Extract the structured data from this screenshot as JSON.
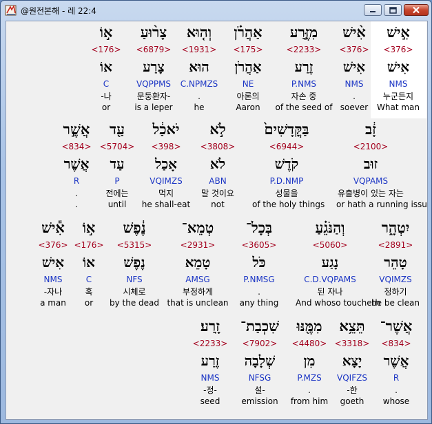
{
  "window": {
    "title": "@원전본해 - 레 22:4",
    "controls": {
      "minimize": "minimize",
      "maximize": "maximize",
      "close": "close"
    }
  },
  "icons": {
    "app": "book-icon"
  },
  "colors": {
    "strong": "#a3001d",
    "parse": "#1a34c4",
    "highlight": "#ffffff"
  },
  "verse_lines": [
    {
      "words": [
        {
          "heb": "אִ֣ישׁ",
          "strong": "<376>",
          "lemma": "אִישׁ",
          "parse": "NMS",
          "kor": "누군든지",
          "eng": "What man"
        },
        {
          "heb": "אִ֨ישׁ",
          "strong": "<376>",
          "lemma": "אִישׁ",
          "parse": "NMS",
          "kor": ".",
          "eng": "soever"
        },
        {
          "heb": "מִזֶּ֣רַע",
          "strong": "<2233>",
          "lemma": "זֶרַע",
          "parse": "P.NMS",
          "kor": "자손 중",
          "eng": "of the seed of"
        },
        {
          "heb": "אַהֲרֹ֗ן",
          "strong": "<175>",
          "lemma": "אַהֲרֹן",
          "parse": "NE",
          "kor": "아론의",
          "eng": "Aaron"
        },
        {
          "heb": "וְה֤וּא",
          "strong": "<1931>",
          "lemma": "הוּא",
          "parse": "C.NPMZS",
          "kor": ".",
          "eng": "he"
        },
        {
          "heb": "צָר֨וּעַ",
          "strong": "<6879>",
          "lemma": "צָרַע",
          "parse": "VQPPMS",
          "kor": "문둥환자-",
          "eng": "is a leper"
        },
        {
          "heb": "א֣וֹ",
          "strong": "<176>",
          "lemma": "אוֹ",
          "parse": "C",
          "kor": "-나",
          "eng": "or"
        }
      ]
    },
    {
      "words": [
        {
          "heb": "זָ֔ב",
          "strong": "<2100>",
          "lemma": "זוּב",
          "parse": "VQPAMS",
          "kor": "유출병이 있는 자는",
          "eng": "or hath a running issue"
        },
        {
          "heb": "בַּקֳּדָשִׁים֙",
          "strong": "<6944>",
          "lemma": "קֹדֶשׁ",
          "parse": "P.D.NMP",
          "kor": "성물을",
          "eng": "of the holy things"
        },
        {
          "heb": "לֹ֣א",
          "strong": "<3808>",
          "lemma": "לֹא",
          "parse": "ABN",
          "kor": "말 것이요",
          "eng": "not"
        },
        {
          "heb": "יֹאכַ֔ל",
          "strong": "<398>",
          "lemma": "אָכַל",
          "parse": "VQIMZS",
          "kor": "먹지",
          "eng": "he shall-eat"
        },
        {
          "heb": "עַ֖ד",
          "strong": "<5704>",
          "lemma": "עַד",
          "parse": "P",
          "kor": "전에는",
          "eng": "until"
        },
        {
          "heb": "אֲשֶׁ֣ר",
          "strong": "<834>",
          "lemma": "אֲשֶׁר",
          "parse": "R",
          "kor": ".",
          "eng": "."
        }
      ]
    },
    {
      "words": [
        {
          "heb": "יִטְהָ֑ר",
          "strong": "<2891>",
          "lemma": "טָהֵר",
          "parse": "VQIMZS",
          "kor": "정하기",
          "eng": "he be clean"
        },
        {
          "heb": "וְהַנֹּגֵ֗עַ",
          "strong": "<5060>",
          "lemma": "נָגַע",
          "parse": "C.D.VQPAMS",
          "kor": "된 자나",
          "eng": "And whoso toucheth"
        },
        {
          "heb": "בְּכָל־",
          "strong": "<3605>",
          "lemma": "כֹּל",
          "parse": "P.NMSG",
          "kor": ".",
          "eng": "any thing"
        },
        {
          "heb": "טְמֵא־",
          "strong": "<2931>",
          "lemma": "טָמֵא",
          "parse": "AMSG",
          "kor": "부정하게",
          "eng": "that is unclean"
        },
        {
          "heb": "נֶ֔פֶשׁ",
          "strong": "<5315>",
          "lemma": "נֶפֶשׁ",
          "parse": "NFS",
          "kor": "시체로",
          "eng": "by the dead"
        },
        {
          "heb": "א֣וֹ",
          "strong": "<176>",
          "lemma": "אוֹ",
          "parse": "C",
          "kor": "혹",
          "eng": "or"
        },
        {
          "heb": "אִ֕ישׁ",
          "strong": "<376>",
          "lemma": "אִישׁ",
          "parse": "NMS",
          "kor": "-자나",
          "eng": "a man"
        }
      ]
    },
    {
      "words": [
        {
          "heb": "אֲשֶׁר־",
          "strong": "<834>",
          "lemma": "אֲשֶׁר",
          "parse": "R",
          "kor": ".",
          "eng": "whose"
        },
        {
          "heb": "תֵּצֵ֥א",
          "strong": "<3318>",
          "lemma": "יָצָא",
          "parse": "VQIFZS",
          "kor": "-한",
          "eng": "goeth"
        },
        {
          "heb": "מִמֶּ֖נּוּ",
          "strong": "<4480>",
          "lemma": "מִן",
          "parse": "P.MZS",
          "kor": ".",
          "eng": "from him"
        },
        {
          "heb": "שִׁכְבַת־",
          "strong": "<7902>",
          "lemma": "שְׁלָבָה",
          "parse": "NFSG",
          "kor": "설-",
          "eng": "emission"
        },
        {
          "heb": "זָֽרַע׃",
          "strong": "<2233>",
          "lemma": "זֶרַע",
          "parse": "NMS",
          "kor": "-정-",
          "eng": "seed"
        }
      ]
    }
  ]
}
